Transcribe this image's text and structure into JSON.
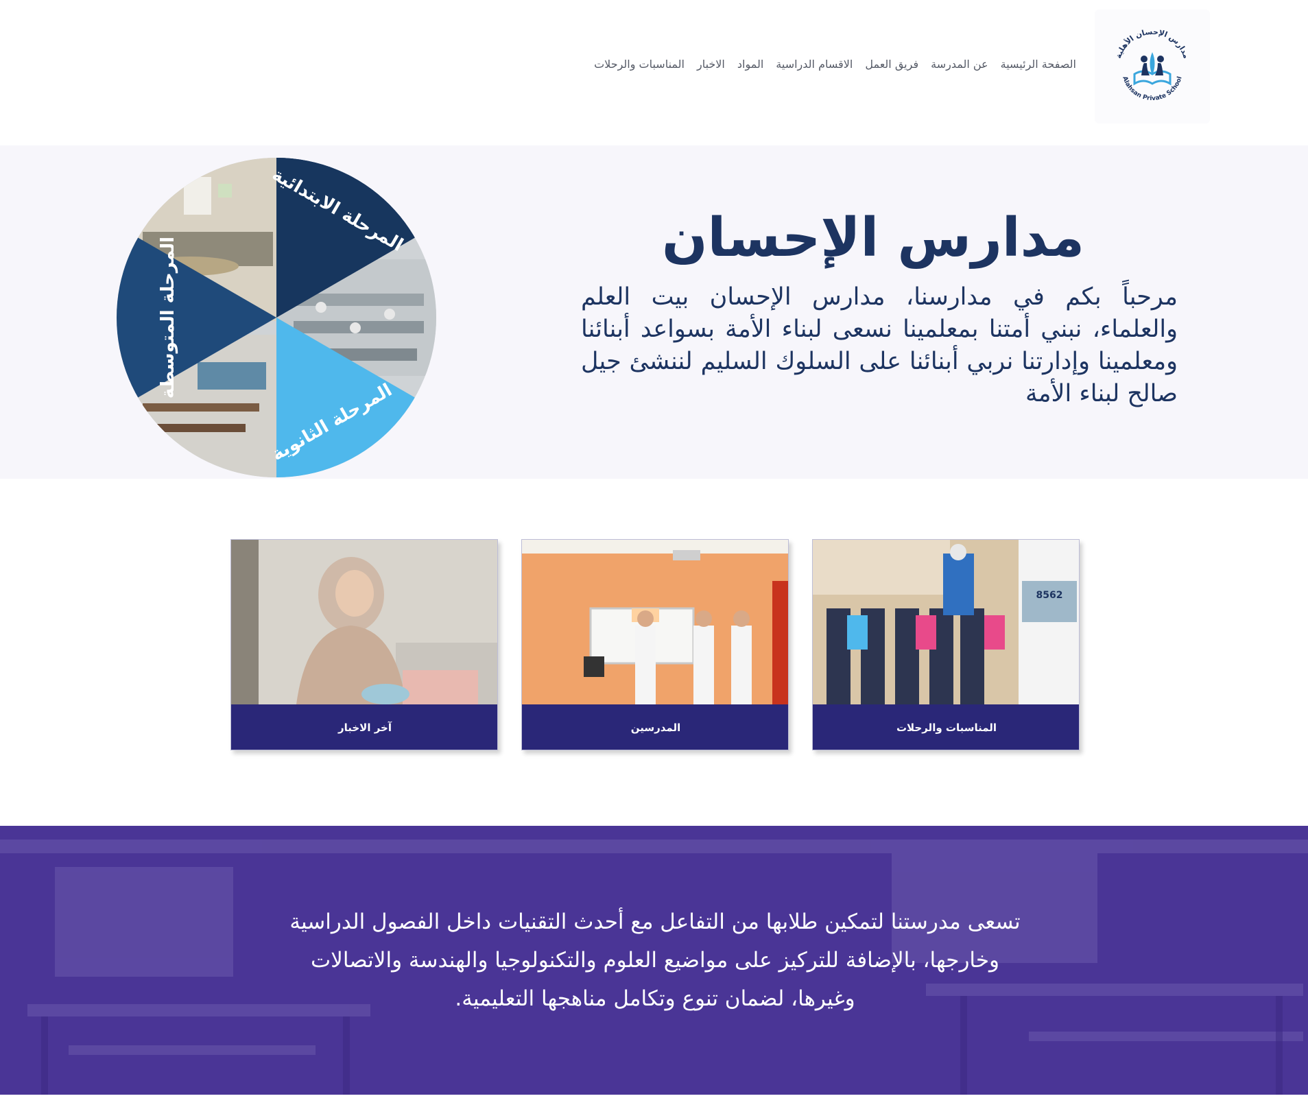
{
  "nav": {
    "items": [
      "الصفحة الرئيسية",
      "عن المدرسة",
      "فريق العمل",
      "الاقسام الدراسية",
      "المواد",
      "الاخبار",
      "المناسبات والرحلات"
    ]
  },
  "logo": {
    "arabic": "مدارس الإحسان الأهلية",
    "english": "Alahsan Private School"
  },
  "hero": {
    "title": "مدارس الإحسان",
    "text": "مرحباً بكم في مدارسنا، مدارس الإحسان بيت العلم والعلماء، نبني أمتنا بمعلمينا نسعى لبناء الأمة بسواعد أبنائنا ومعلمينا وإدارتنا نربي أبنائنا على السلوك السليم لننشئ جيل صالح لبناء الأمة",
    "wheel": {
      "primary": "المرحلة الابتدائية",
      "middle": "المرحلة المتوسطة",
      "secondary": "المرحلة الثانوية"
    }
  },
  "cards": [
    {
      "label": "آخر الاخبار",
      "image": "teacher-laptop-photo"
    },
    {
      "label": "المدرسين",
      "image": "classroom-teachers-photo"
    },
    {
      "label": "المناسبات والرحلات",
      "image": "students-bus-trip-photo"
    }
  ],
  "banner": {
    "text": "تسعى مدرستنا لتمكين طلابها من التفاعل مع أحدث التقنيات داخل الفصول الدراسية وخارجها، بالإضافة للتركيز على مواضيع العلوم والتكنولوجيا والهندسة والاتصالات وغيرها، لضمان تنوع وتكامل مناهجها التعليمية."
  },
  "colors": {
    "navy": "#1d3461",
    "wheel_dark": "#17365e",
    "wheel_mid": "#1f4a7a",
    "wheel_light": "#4fb8ec",
    "card_label_bg": "#2a2778",
    "banner_bg": "#4a3596"
  }
}
